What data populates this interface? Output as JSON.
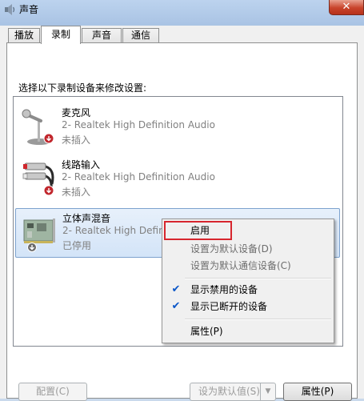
{
  "window": {
    "title": "声音",
    "close_glyph": "✕"
  },
  "tabs": [
    {
      "label": "播放"
    },
    {
      "label": "录制"
    },
    {
      "label": "声音"
    },
    {
      "label": "通信"
    }
  ],
  "instruction": "选择以下录制设备来修改设置:",
  "devices": [
    {
      "name": "麦克风",
      "description": "2- Realtek High Definition Audio",
      "status": "未插入",
      "icon": "microphone-icon"
    },
    {
      "name": "线路输入",
      "description": "2- Realtek High Definition Audio",
      "status": "未插入",
      "icon": "line-in-rca-icon"
    },
    {
      "name": "立体声混音",
      "description": "2- Realtek High Definition Audio",
      "status": "已停用",
      "icon": "sound-card-icon"
    }
  ],
  "context_menu": {
    "enable": "启用",
    "set_default": "设置为默认设备(D)",
    "set_default_comm": "设置为默认通信设备(C)",
    "show_disabled": "显示禁用的设备",
    "show_disconnected": "显示已断开的设备",
    "properties": "属性(P)",
    "check_glyph": "✔"
  },
  "buttons": {
    "configure": "配置(C)",
    "set_default": "设为默认值(S)",
    "dropdown_glyph": "▼",
    "properties": "属性(P)"
  },
  "colors": {
    "accent": "#0a56c8",
    "highlight_box": "#d7262e",
    "selection": "#d3e4f8"
  }
}
